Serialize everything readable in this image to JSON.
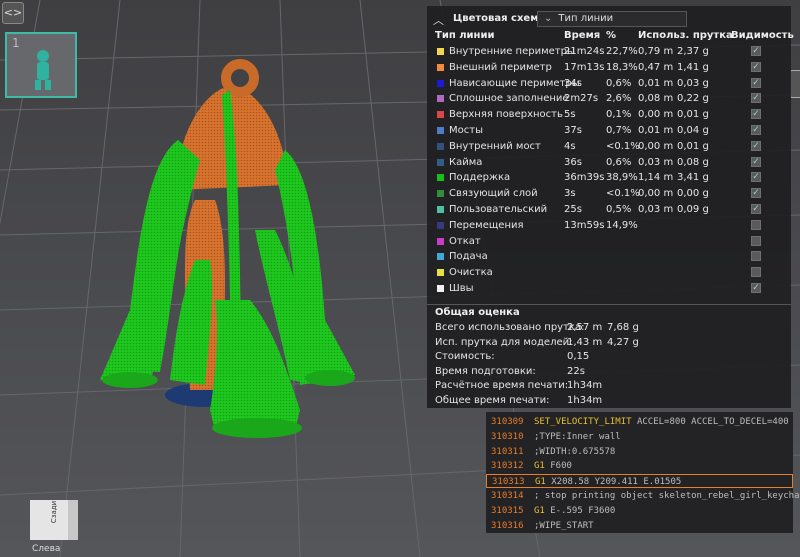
{
  "ui": {
    "collapse_icon": "<>",
    "plate_number": "1"
  },
  "legend": {
    "title": "Цветовая схема",
    "view_mode": "Тип линии",
    "columns": {
      "type": "Тип линии",
      "time": "Время",
      "percent": "%",
      "filament": "Использ. прутка",
      "visibility": "Видимость"
    },
    "rows": [
      {
        "color": "#f2d650",
        "name": "Внутренние периметры",
        "time": "21m24s",
        "percent": "22,7%",
        "length": "0,79 m",
        "weight": "2,37 g",
        "visible": true
      },
      {
        "color": "#f08a3c",
        "name": "Внешний периметр",
        "time": "17m13s",
        "percent": "18,3%",
        "length": "0,47 m",
        "weight": "1,41 g",
        "visible": true
      },
      {
        "color": "#1a1ad8",
        "name": "Нависающие периметры",
        "time": "34s",
        "percent": "0,6%",
        "length": "0,01 m",
        "weight": "0,03 g",
        "visible": true
      },
      {
        "color": "#b06ac0",
        "name": "Сплошное заполнение",
        "time": "2m27s",
        "percent": "2,6%",
        "length": "0,08 m",
        "weight": "0,22 g",
        "visible": true
      },
      {
        "color": "#d84848",
        "name": "Верхняя поверхность",
        "time": "5s",
        "percent": "0,1%",
        "length": "0,00 m",
        "weight": "0,01 g",
        "visible": true
      },
      {
        "color": "#4f7cc6",
        "name": "Мосты",
        "time": "37s",
        "percent": "0,7%",
        "length": "0,01 m",
        "weight": "0,04 g",
        "visible": true
      },
      {
        "color": "#33517a",
        "name": "Внутренний мост",
        "time": "4s",
        "percent": "<0.1%",
        "length": "0,00 m",
        "weight": "0,01 g",
        "visible": true
      },
      {
        "color": "#2f5f88",
        "name": "Кайма",
        "time": "36s",
        "percent": "0,6%",
        "length": "0,03 m",
        "weight": "0,08 g",
        "visible": true
      },
      {
        "color": "#17c017",
        "name": "Поддержка",
        "time": "36m39s",
        "percent": "38,9%",
        "length": "1,14 m",
        "weight": "3,41 g",
        "visible": true
      },
      {
        "color": "#2f8f3a",
        "name": "Связующий слой",
        "time": "3s",
        "percent": "<0.1%",
        "length": "0,00 m",
        "weight": "0,00 g",
        "visible": true
      },
      {
        "color": "#4fc0a0",
        "name": "Пользовательский",
        "time": "25s",
        "percent": "0,5%",
        "length": "0,03 m",
        "weight": "0,09 g",
        "visible": true
      },
      {
        "color": "#383880",
        "name": "Перемещения",
        "time": "13m59s",
        "percent": "14,9%",
        "length": "",
        "weight": "",
        "visible": false
      },
      {
        "color": "#c83cc8",
        "name": "Откат",
        "time": "",
        "percent": "",
        "length": "",
        "weight": "",
        "visible": false
      },
      {
        "color": "#3faad8",
        "name": "Подача",
        "time": "",
        "percent": "",
        "length": "",
        "weight": "",
        "visible": false
      },
      {
        "color": "#e8e040",
        "name": "Очистка",
        "time": "",
        "percent": "",
        "length": "",
        "weight": "",
        "visible": false
      },
      {
        "color": "#f0f0f0",
        "name": "Швы",
        "time": "",
        "percent": "",
        "length": "",
        "weight": "",
        "visible": true
      }
    ],
    "estimate": {
      "title": "Общая оценка",
      "rows": [
        {
          "label": "Всего использовано прутка:",
          "v1": "2,57 m",
          "v2": "7,68 g"
        },
        {
          "label": "Исп. прутка для моделей:",
          "v1": "1,43 m",
          "v2": "4,27 g"
        },
        {
          "label": "Стоимость:",
          "v1": "0,15",
          "v2": ""
        },
        {
          "label": "Время подготовки:",
          "v1": "22s",
          "v2": ""
        },
        {
          "label": "Расчётное время печати:",
          "v1": "1h34m",
          "v2": ""
        },
        {
          "label": "Общее время печати:",
          "v1": "1h34m",
          "v2": ""
        }
      ]
    }
  },
  "gcode": {
    "lines": [
      {
        "no": "310309",
        "kw": "SET_VELOCITY_LIMIT",
        "rest": " ACCEL=800 ACCEL_TO_DECEL=400",
        "current": false
      },
      {
        "no": "310310",
        "kw": "",
        "rest": ";TYPE:Inner wall",
        "current": false
      },
      {
        "no": "310311",
        "kw": "",
        "rest": ";WIDTH:0.675578",
        "current": false
      },
      {
        "no": "310312",
        "kw": "G1",
        "rest": " F600",
        "current": false
      },
      {
        "no": "310313",
        "kw": "G1",
        "rest": " X208.58 Y209.411 E.01505",
        "current": true
      },
      {
        "no": "310314",
        "kw": "",
        "rest": "; stop printing object skeleton_rebel_girl_keychain....",
        "current": false
      },
      {
        "no": "310315",
        "kw": "G1",
        "rest": " E-.595 F3600",
        "current": false
      },
      {
        "no": "310316",
        "kw": "",
        "rest": ";WIPE_START",
        "current": false
      }
    ]
  },
  "view_cube": {
    "front_label": "Слева",
    "side_label": "Сзади"
  }
}
